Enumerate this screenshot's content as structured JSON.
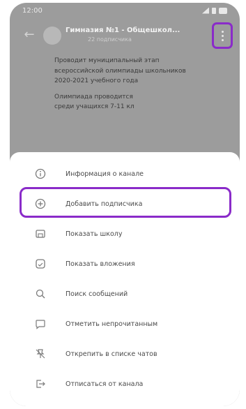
{
  "status_bar": {
    "time": "12:00"
  },
  "header": {
    "title": "Гимназия №1 - Общешкол...",
    "subtitle": "22 подписчика"
  },
  "message": {
    "paragraph1": "Проводит муниципальный этап всероссийской олимпиады школьников 2020-2021 учебного года",
    "paragraph2_line1": "Олимпиада проводится",
    "paragraph2_line2": "среди учащихся 7-11 кл"
  },
  "menu": {
    "items": [
      {
        "label": "Информация о канале",
        "icon": "info-icon"
      },
      {
        "label": "Добавить подписчика",
        "icon": "add-icon"
      },
      {
        "label": "Показать школу",
        "icon": "school-icon"
      },
      {
        "label": "Показать вложения",
        "icon": "attachments-icon"
      },
      {
        "label": "Поиск сообщений",
        "icon": "search-icon"
      },
      {
        "label": "Отметить непрочитанным",
        "icon": "unread-icon"
      },
      {
        "label": "Открепить в списке чатов",
        "icon": "unpin-icon"
      },
      {
        "label": "Отписаться от канала",
        "icon": "leave-icon"
      }
    ]
  },
  "colors": {
    "highlight": "#8a2bc9",
    "overlay": "#9c9c9c"
  }
}
